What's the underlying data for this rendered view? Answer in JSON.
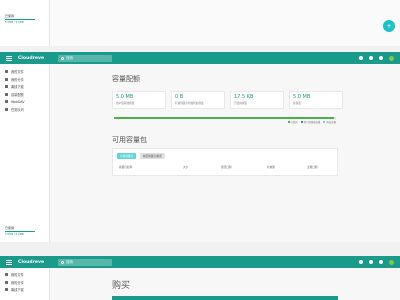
{
  "app": {
    "brand": "Cloudreve",
    "search_placeholder": "搜索"
  },
  "sidebar": {
    "items": [
      {
        "label": "我的文件"
      },
      {
        "label": "我的分享"
      },
      {
        "label": "离线下载"
      },
      {
        "label": "容量配额"
      },
      {
        "label": "WebDAV"
      },
      {
        "label": "任务队列"
      }
    ],
    "footer": {
      "label": "已使用",
      "sub": "5.0MB / 5.0MB"
    }
  },
  "section_top": {
    "sidebar_footer": {
      "label": "已使用",
      "sub": "5.0MB / 5.0MB"
    },
    "fab_icon": "plus-icon"
  },
  "quota": {
    "title": "容量配额",
    "stats": [
      {
        "value": "5.0 MB",
        "label": "用户组基础容量"
      },
      {
        "value": "0 B",
        "label": "有效容量包附加附加容量"
      },
      {
        "value": "17.5 KB",
        "label": "已使用容量"
      },
      {
        "value": "5.0 MB",
        "label": "总容量"
      }
    ],
    "used_fraction": 0.99,
    "legend": [
      "已使用",
      "用户组基础容量",
      "附加容量"
    ]
  },
  "packs": {
    "title": "可用容量包",
    "tabs": {
      "active": "可用容量包",
      "idle": "购买容量包/购买"
    },
    "row": {
      "c1": "容量包名称",
      "c2": "大小",
      "c3": "激活日期",
      "c4": "有效期",
      "c5": "过期日期"
    }
  },
  "buy": {
    "title": "购买"
  },
  "colors": {
    "primary": "#1a9a8a",
    "accent": "#5fd4d9",
    "progress": "#4caf50",
    "fab": "#1ec1c7"
  }
}
